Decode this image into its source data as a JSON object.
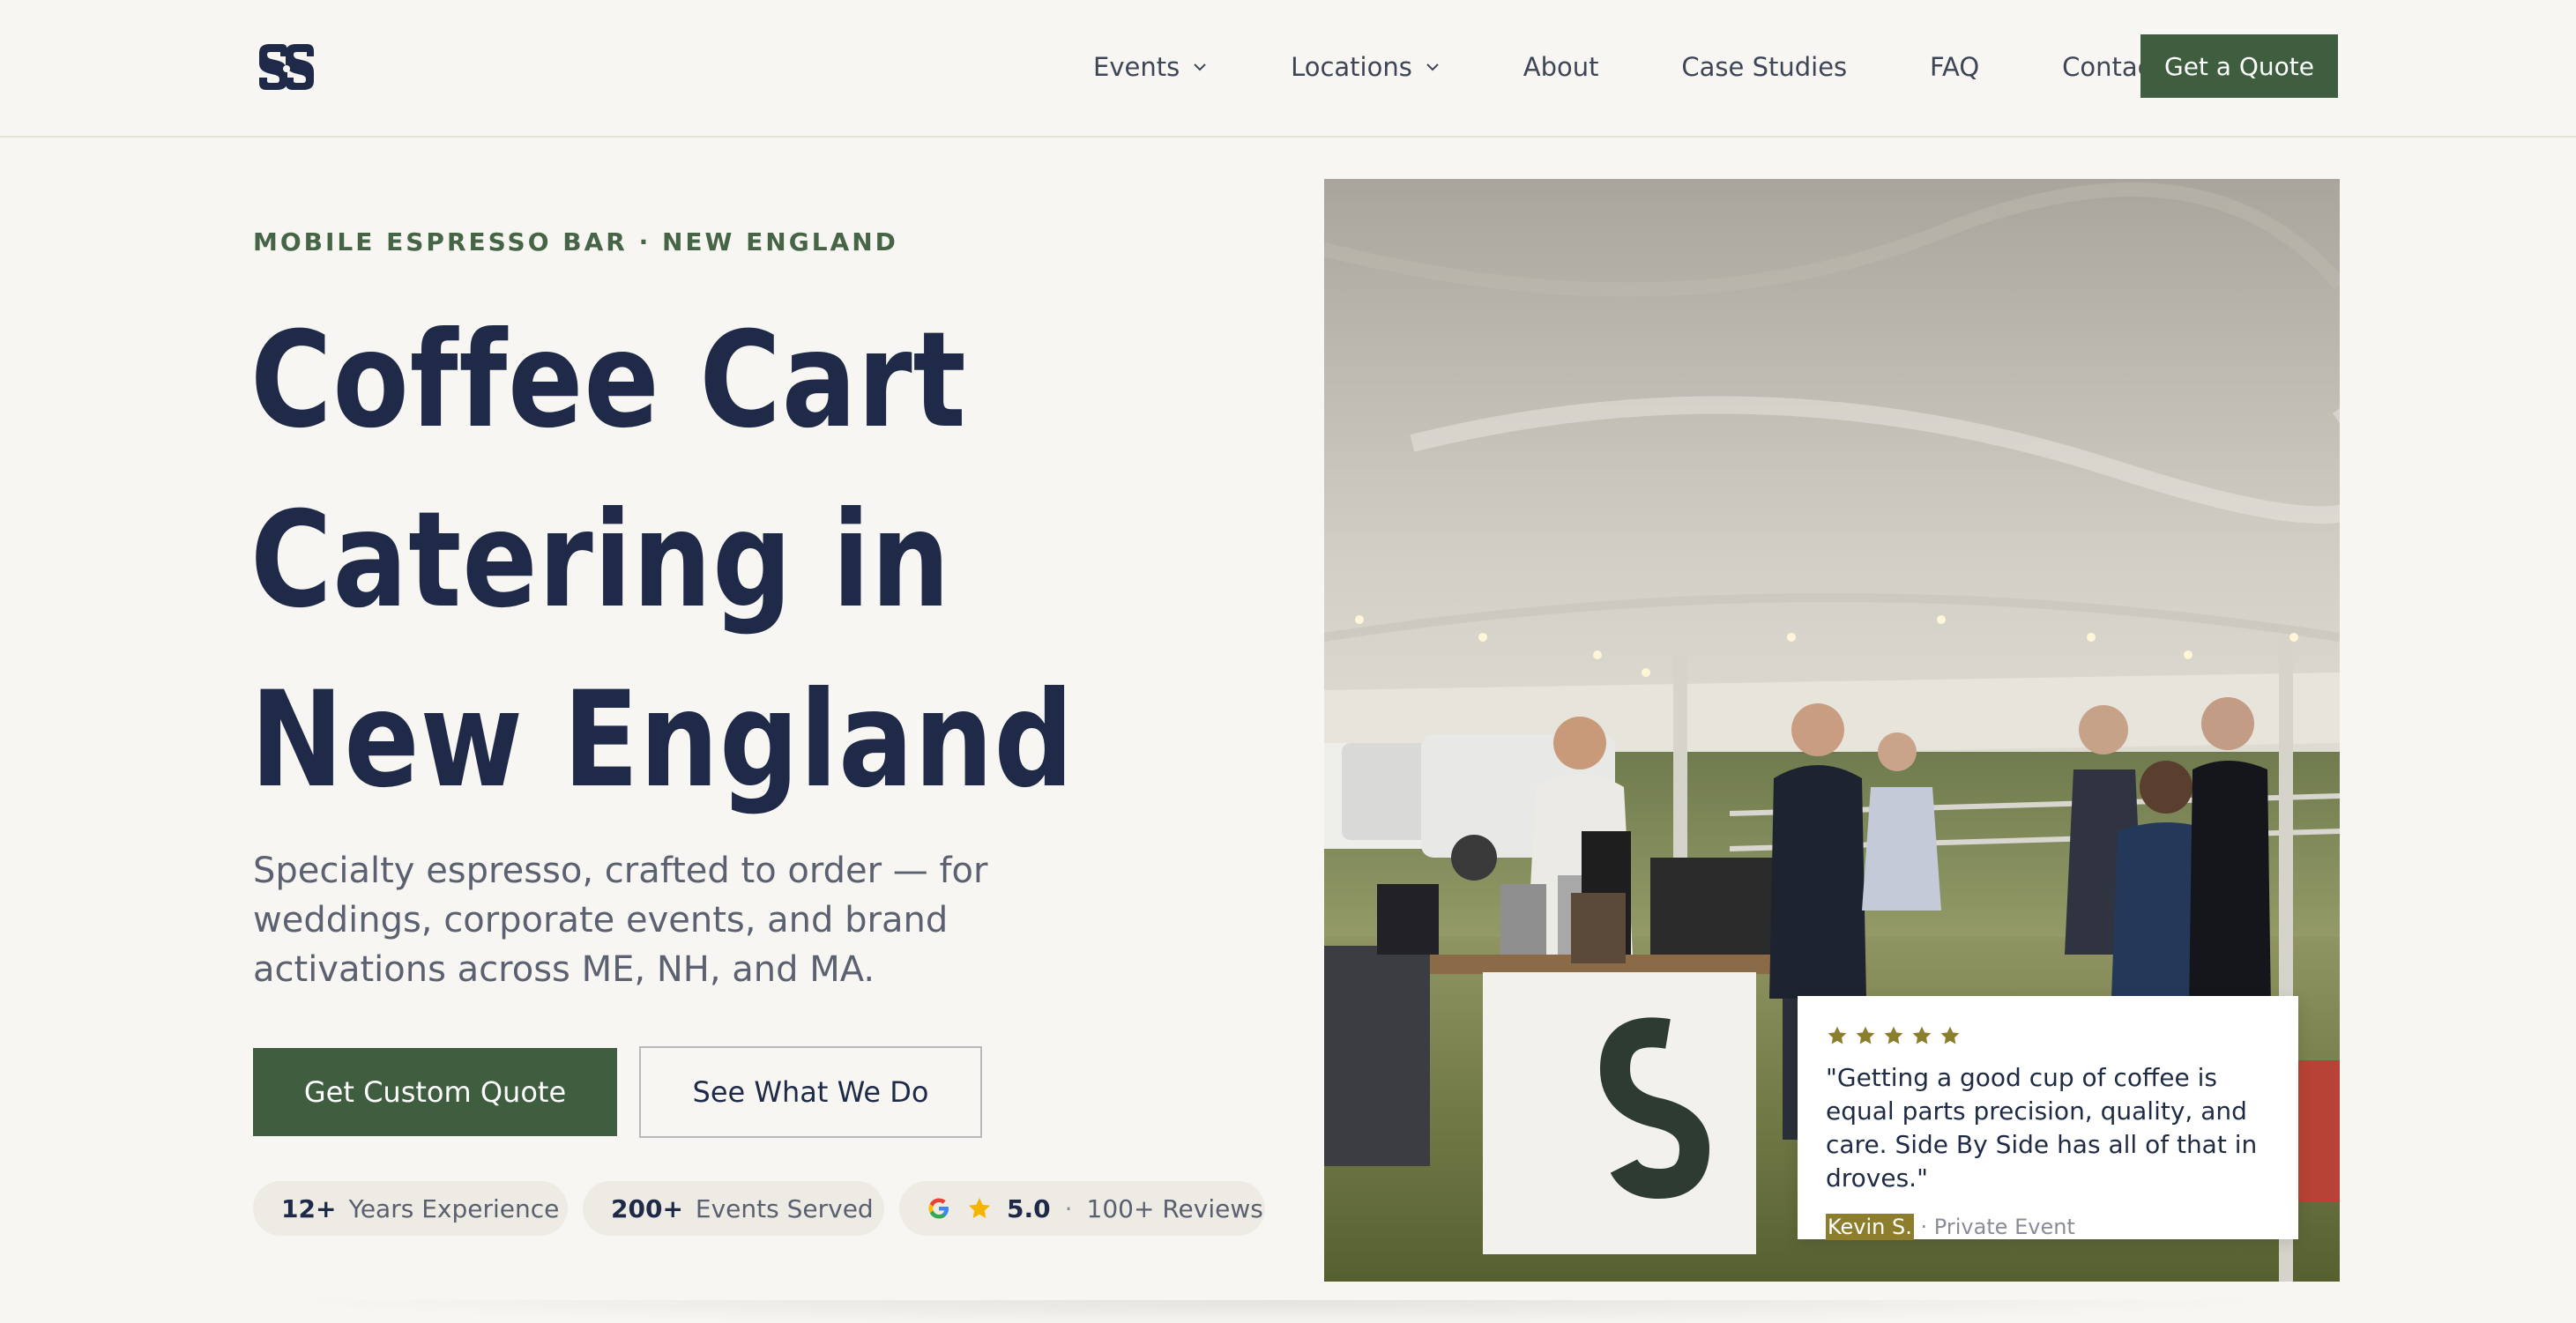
{
  "nav": {
    "items": [
      {
        "label": "Events",
        "dropdown": true
      },
      {
        "label": "Locations",
        "dropdown": true
      },
      {
        "label": "About",
        "dropdown": false
      },
      {
        "label": "Case Studies",
        "dropdown": false
      },
      {
        "label": "FAQ",
        "dropdown": false
      },
      {
        "label": "Contact",
        "dropdown": false
      }
    ],
    "cta_label": "Get a Quote"
  },
  "hero": {
    "eyebrow": "MOBILE ESPRESSO BAR · NEW ENGLAND",
    "title_lines": [
      "Coffee Cart",
      "Catering in",
      "New England"
    ],
    "subtitle": "Specialty espresso, crafted to order — for weddings, corporate events, and brand activations across ME, NH, and MA.",
    "primary_cta": "Get Custom Quote",
    "secondary_cta": "See What We Do"
  },
  "stats": [
    {
      "value": "12+",
      "label": "Years Experience"
    },
    {
      "value": "200+",
      "label": "Events Served"
    }
  ],
  "reviews_pill": {
    "rating": "5.0",
    "separator": "·",
    "count_label": "100+ Reviews"
  },
  "review_card": {
    "stars": 5,
    "quote": "\"Getting a good cup of coffee is equal parts precision, quality, and care. Side By Side has all of that in droves.\"",
    "name": "Kevin S.",
    "context": " · Private Event"
  },
  "colors": {
    "brand_green": "#3f5d3f",
    "navy": "#1e2a48",
    "background": "#f8f6f2",
    "star_gold": "#8d7e2e"
  }
}
